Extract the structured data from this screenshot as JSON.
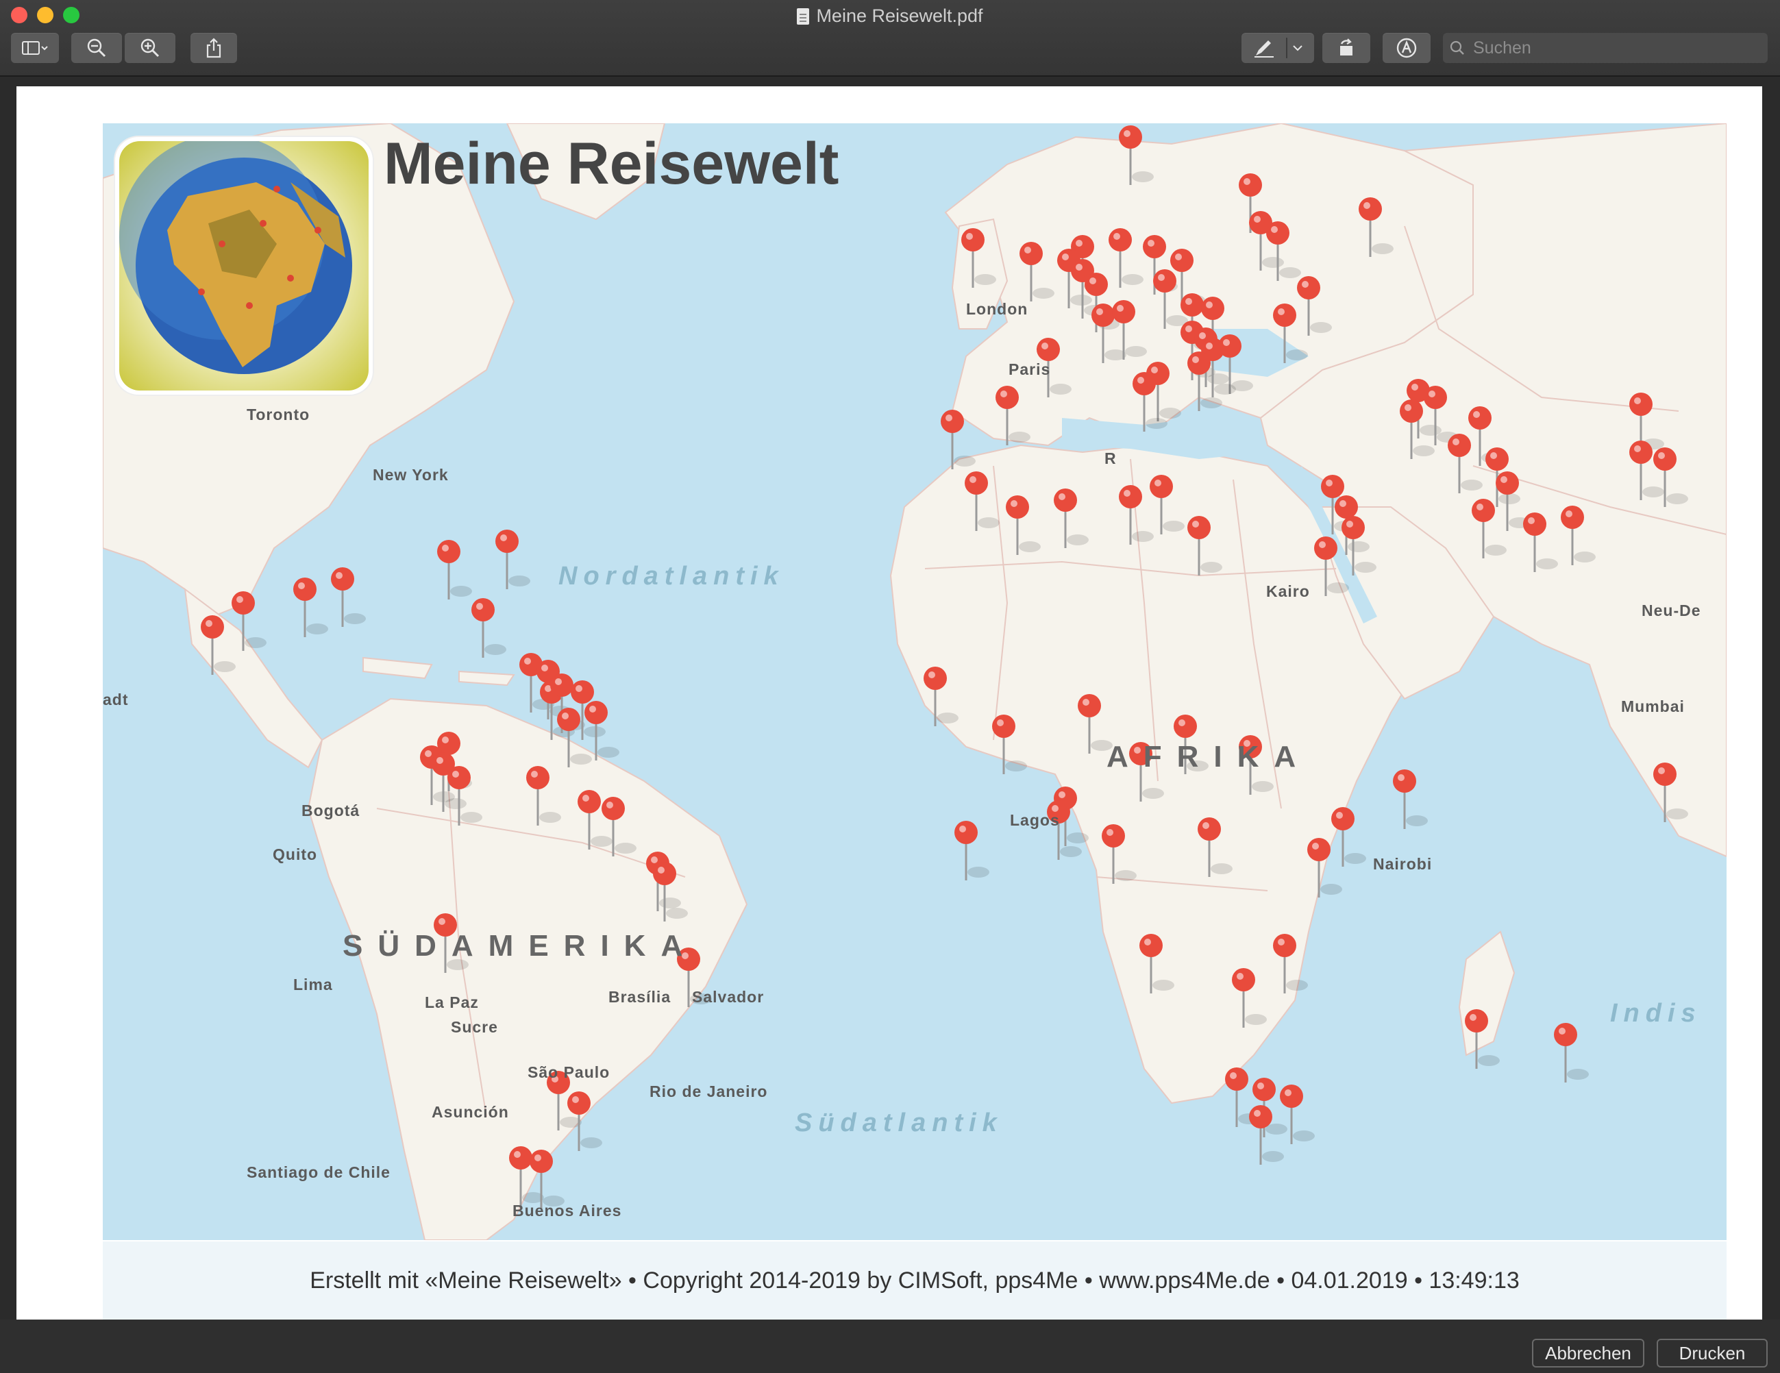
{
  "window": {
    "title": "Meine Reisewelt.pdf"
  },
  "toolbar": {
    "search_placeholder": "Suchen"
  },
  "map": {
    "title": "Meine Reisewelt",
    "oceans": [
      "Nordatlantik",
      "Südatlantik",
      "Indis"
    ],
    "continents": [
      "AFRIKA",
      "SÜDAMERIKA"
    ],
    "cities": [
      "London",
      "Paris",
      "Toronto",
      "New York",
      "Kairo",
      "Neu-De",
      "Mumbai",
      "Lagos",
      "Nairobi",
      "Bogotá",
      "Quito",
      "Lima",
      "La Paz",
      "Sucre",
      "Brasília",
      "Salvador",
      "São Paulo",
      "Rio de Janeiro",
      "Asunción",
      "Santiago de Chile",
      "Buenos Aires",
      "R",
      "adt"
    ]
  },
  "footer": {
    "text": "Erstellt mit «Meine Reisewelt» • Copyright 2014-2019 by CIMSoft, pps4Me • www.pps4Me.de • 04.01.2019 • 13:49:13"
  },
  "buttons": {
    "cancel": "Abbrechen",
    "print": "Drucken"
  },
  "colors": {
    "pin": "#e84b3c",
    "water": "#c2e2f1",
    "land": "#f6f3ec"
  }
}
